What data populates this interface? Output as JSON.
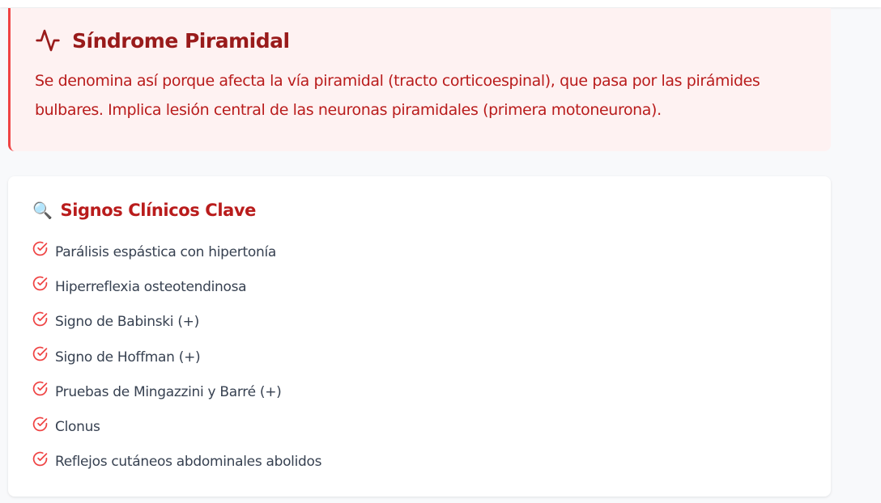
{
  "alert": {
    "icon": "activity-pulse-icon",
    "title": "Síndrome Piramidal",
    "text": "Se denomina así porque afecta la vía piramidal (tracto corticoespinal), que pasa por las pirámides bulbares. Implica lesión central de las neuronas piramidales (primera motoneurona).",
    "colors": {
      "border": "#ef4444",
      "background": "#fef2f2",
      "title": "#991b1b",
      "text": "#b91c1c"
    }
  },
  "signs": {
    "icon": "magnifying-glass-icon",
    "title": "Signos Clínicos Clave",
    "items": [
      {
        "label": "Parálisis espástica con hipertonía"
      },
      {
        "label": "Hiperreflexia osteotendinosa"
      },
      {
        "label": "Signo de Babinski (+)"
      },
      {
        "label": "Signo de Hoffman (+)"
      },
      {
        "label": "Pruebas de Mingazzini y Barré (+)"
      },
      {
        "label": "Clonus"
      },
      {
        "label": "Reflejos cutáneos abdominales abolidos"
      }
    ]
  }
}
